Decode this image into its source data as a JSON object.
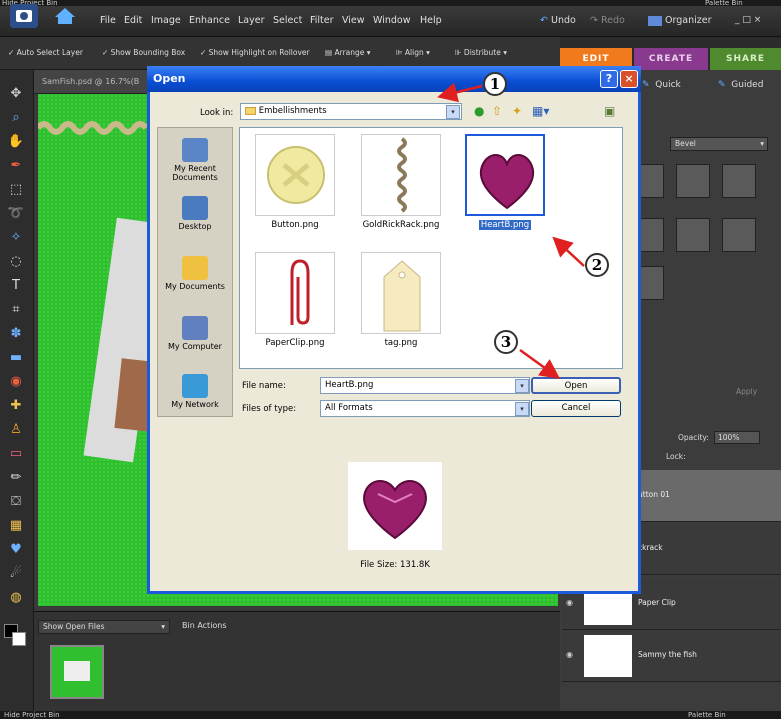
{
  "top_strip": {
    "left": "Hide Project Bin",
    "right": "Palette Bin"
  },
  "menu": {
    "items": [
      "File",
      "Edit",
      "Image",
      "Enhance",
      "Layer",
      "Select",
      "Filter",
      "View",
      "Window",
      "Help"
    ],
    "undo": "Undo",
    "redo": "Redo",
    "organizer": "Organizer",
    "window_controls": "_  □  ×"
  },
  "options": {
    "auto_select": "Auto Select Layer",
    "bounding_box": "Show Bounding Box",
    "highlight": "Show Highlight on Rollover",
    "arrange": "Arrange",
    "align": "Align",
    "distribute": "Distribute"
  },
  "mode_tabs": {
    "edit": "EDIT",
    "create": "CREATE",
    "share": "SHARE"
  },
  "panel": {
    "quick": "Quick",
    "guided": "Guided",
    "bevel": "Bevel",
    "apply": "Apply",
    "opacity_label": "Opacity:",
    "opacity_value": "100%",
    "lock": "Lock:"
  },
  "layers": [
    {
      "name": "utton 01"
    },
    {
      "name": "ckrack"
    },
    {
      "name": "Paper Clip"
    },
    {
      "name": "Sammy the fish"
    }
  ],
  "document": {
    "tab": "SamFish.psd @ 16.7%(B"
  },
  "project_bin": {
    "dropdown": "Show Open Files",
    "actions": "Bin Actions"
  },
  "bottom_bar": {
    "left": "Hide Project Bin",
    "right": "Palette Bin"
  },
  "dialog": {
    "title": "Open",
    "help": "?",
    "close": "×",
    "look_in_label": "Look in:",
    "look_in_value": "Embellishments",
    "places": [
      "My Recent Documents",
      "Desktop",
      "My Documents",
      "My Computer",
      "My Network"
    ],
    "files": [
      {
        "name": "Button.png",
        "selected": false
      },
      {
        "name": "GoldRickRack.png",
        "selected": false
      },
      {
        "name": "HeartB.png",
        "selected": true
      },
      {
        "name": "PaperClip.png",
        "selected": false
      },
      {
        "name": "tag.png",
        "selected": false
      }
    ],
    "file_name_label": "File name:",
    "file_name_value": "HeartB.png",
    "file_type_label": "Files of type:",
    "file_type_value": "All Formats",
    "open_button": "Open",
    "cancel_button": "Cancel",
    "file_size": "File Size: 131.8K"
  },
  "callouts": [
    "1",
    "2",
    "3"
  ],
  "colors": {
    "accent_blue": "#0a4fd4",
    "edit_tab": "#f07a1c",
    "create_tab": "#8a3a8e",
    "share_tab": "#4f8a2e",
    "canvas_green": "#2fbf2f",
    "arrow_red": "#e02020"
  }
}
